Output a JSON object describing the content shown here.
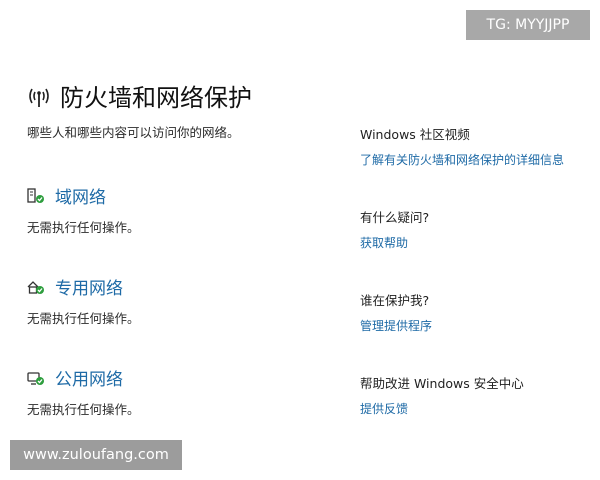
{
  "watermark_top": "TG: MYYJJPP",
  "watermark_bottom": "www.zuloufang.com",
  "header": {
    "icon": "wifi-antenna-icon",
    "title": "防火墙和网络保护",
    "description": "哪些人和哪些内容可以访问你的网络。"
  },
  "networks": [
    {
      "icon": "domain-network-icon",
      "name": "域网络",
      "status": "无需执行任何操作。"
    },
    {
      "icon": "private-network-icon",
      "name": "专用网络",
      "status": "无需执行任何操作。"
    },
    {
      "icon": "public-network-icon",
      "name": "公用网络",
      "status": "无需执行任何操作。"
    }
  ],
  "sidebar": [
    {
      "title": "Windows 社区视频",
      "link": "了解有关防火墙和网络保护的详细信息"
    },
    {
      "title": "有什么疑问?",
      "link": "获取帮助"
    },
    {
      "title": "谁在保护我?",
      "link": "管理提供程序"
    },
    {
      "title": "帮助改进 Windows 安全中心",
      "link": "提供反馈"
    }
  ],
  "colors": {
    "link": "#1e6aa6",
    "check": "#2e9e3e"
  }
}
